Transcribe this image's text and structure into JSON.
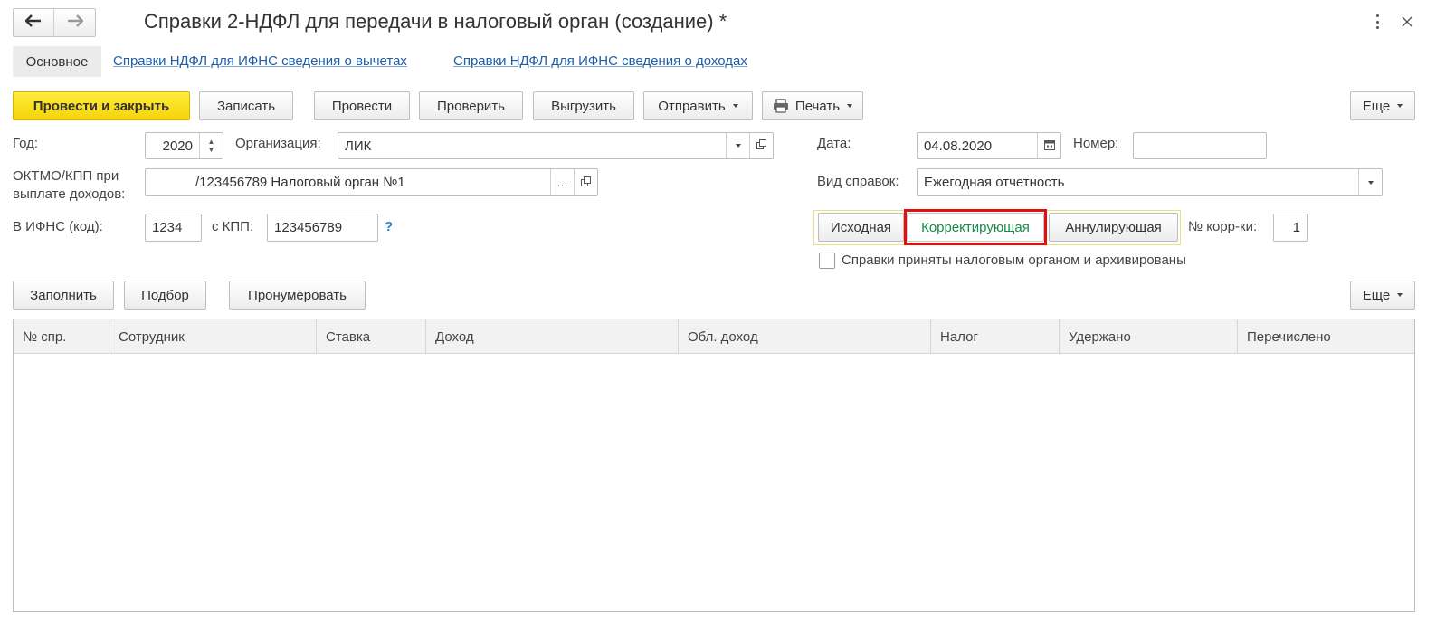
{
  "window": {
    "title": "Справки 2-НДФЛ для передачи в налоговый орган (создание) *",
    "more_icon": "kebab-icon",
    "close_icon": "close-icon"
  },
  "nav": {
    "back_icon": "arrow-left-icon",
    "forward_icon": "arrow-right-icon"
  },
  "tabs": [
    {
      "label": "Основное",
      "active": true
    },
    {
      "label": "Справки НДФЛ для ИФНС сведения о вычетах",
      "active": false
    },
    {
      "label": "Справки НДФЛ для ИФНС сведения о доходах",
      "active": false
    }
  ],
  "toolbar": {
    "post_close": "Провести и закрыть",
    "save": "Записать",
    "post": "Провести",
    "check": "Проверить",
    "export": "Выгрузить",
    "send": "Отправить",
    "print": "Печать",
    "more": "Еще"
  },
  "form": {
    "year_label": "Год:",
    "year_value": "2020",
    "org_label": "Организация:",
    "org_value": "ЛИК",
    "date_label": "Дата:",
    "date_value": "04.08.2020",
    "number_label": "Номер:",
    "number_value": "",
    "oktmo_label_1": "ОКТМО/КПП  при",
    "oktmo_label_2": "выплате доходов:",
    "oktmo_value": "/123456789 Налоговый орган №1",
    "kind_label": "Вид справок:",
    "kind_value": "Ежегодная отчетность",
    "ifns_label": "В ИФНС (код):",
    "ifns_value": "1234",
    "kpp_label": "с КПП:",
    "kpp_value": "123456789",
    "help_mark": "?",
    "type_buttons": [
      "Исходная",
      "Корректирующая",
      "Аннулирующая"
    ],
    "type_selected": "Корректирующая",
    "corr_label": "№ корр-ки:",
    "corr_value": "1",
    "archived_label": "Справки приняты налоговым органом и архивированы",
    "archived_checked": false
  },
  "table_toolbar": {
    "fill": "Заполнить",
    "pick": "Подбор",
    "numerate": "Пронумеровать",
    "more": "Еще"
  },
  "table": {
    "columns": [
      "№ спр.",
      "Сотрудник",
      "Ставка",
      "Доход",
      "Обл. доход",
      "Налог",
      "Удержано",
      "Перечислено"
    ],
    "rows": []
  },
  "colors": {
    "primary_button": "#f5d50a",
    "link": "#1f5da8",
    "selected_type_text": "#1a8a4a",
    "highlight_frame": "#e01010",
    "group_frame": "#e8e27a"
  }
}
